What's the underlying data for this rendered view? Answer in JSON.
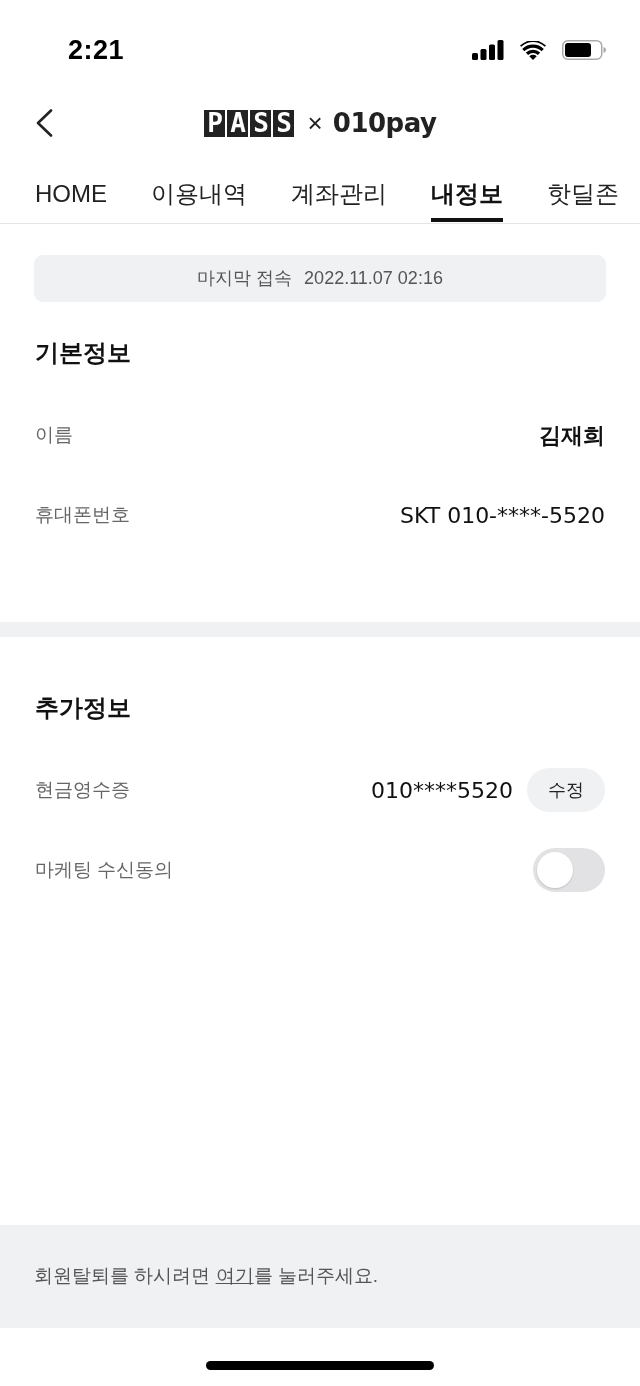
{
  "status_bar": {
    "time": "2:21"
  },
  "header": {
    "logo_left": "PASS",
    "separator": "×",
    "logo_right": "010pay"
  },
  "tabs": [
    {
      "label": "HOME",
      "selected": false
    },
    {
      "label": "이용내역",
      "selected": false
    },
    {
      "label": "계좌관리",
      "selected": false
    },
    {
      "label": "내정보",
      "selected": true
    },
    {
      "label": "핫딜존",
      "selected": false
    }
  ],
  "last_access": {
    "label": "마지막 접속",
    "value": "2022.11.07 02:16"
  },
  "sections": [
    {
      "title": "기본정보",
      "rows": [
        {
          "kind": "text",
          "label": "이름",
          "value": "김재희",
          "bold": true
        },
        {
          "kind": "text",
          "label": "휴대폰번호",
          "value": "SKT 010-****-5520",
          "bold": false
        }
      ]
    },
    {
      "title": "추가정보",
      "rows": [
        {
          "kind": "button",
          "label": "현금영수증",
          "value": "010****5520",
          "button": "수정"
        },
        {
          "kind": "toggle",
          "label": "마케팅 수신동의",
          "on": false
        }
      ]
    }
  ],
  "footer": {
    "before": "회원탈퇴를 하시려면 ",
    "link": "여기",
    "after": "를 눌러주세요."
  }
}
